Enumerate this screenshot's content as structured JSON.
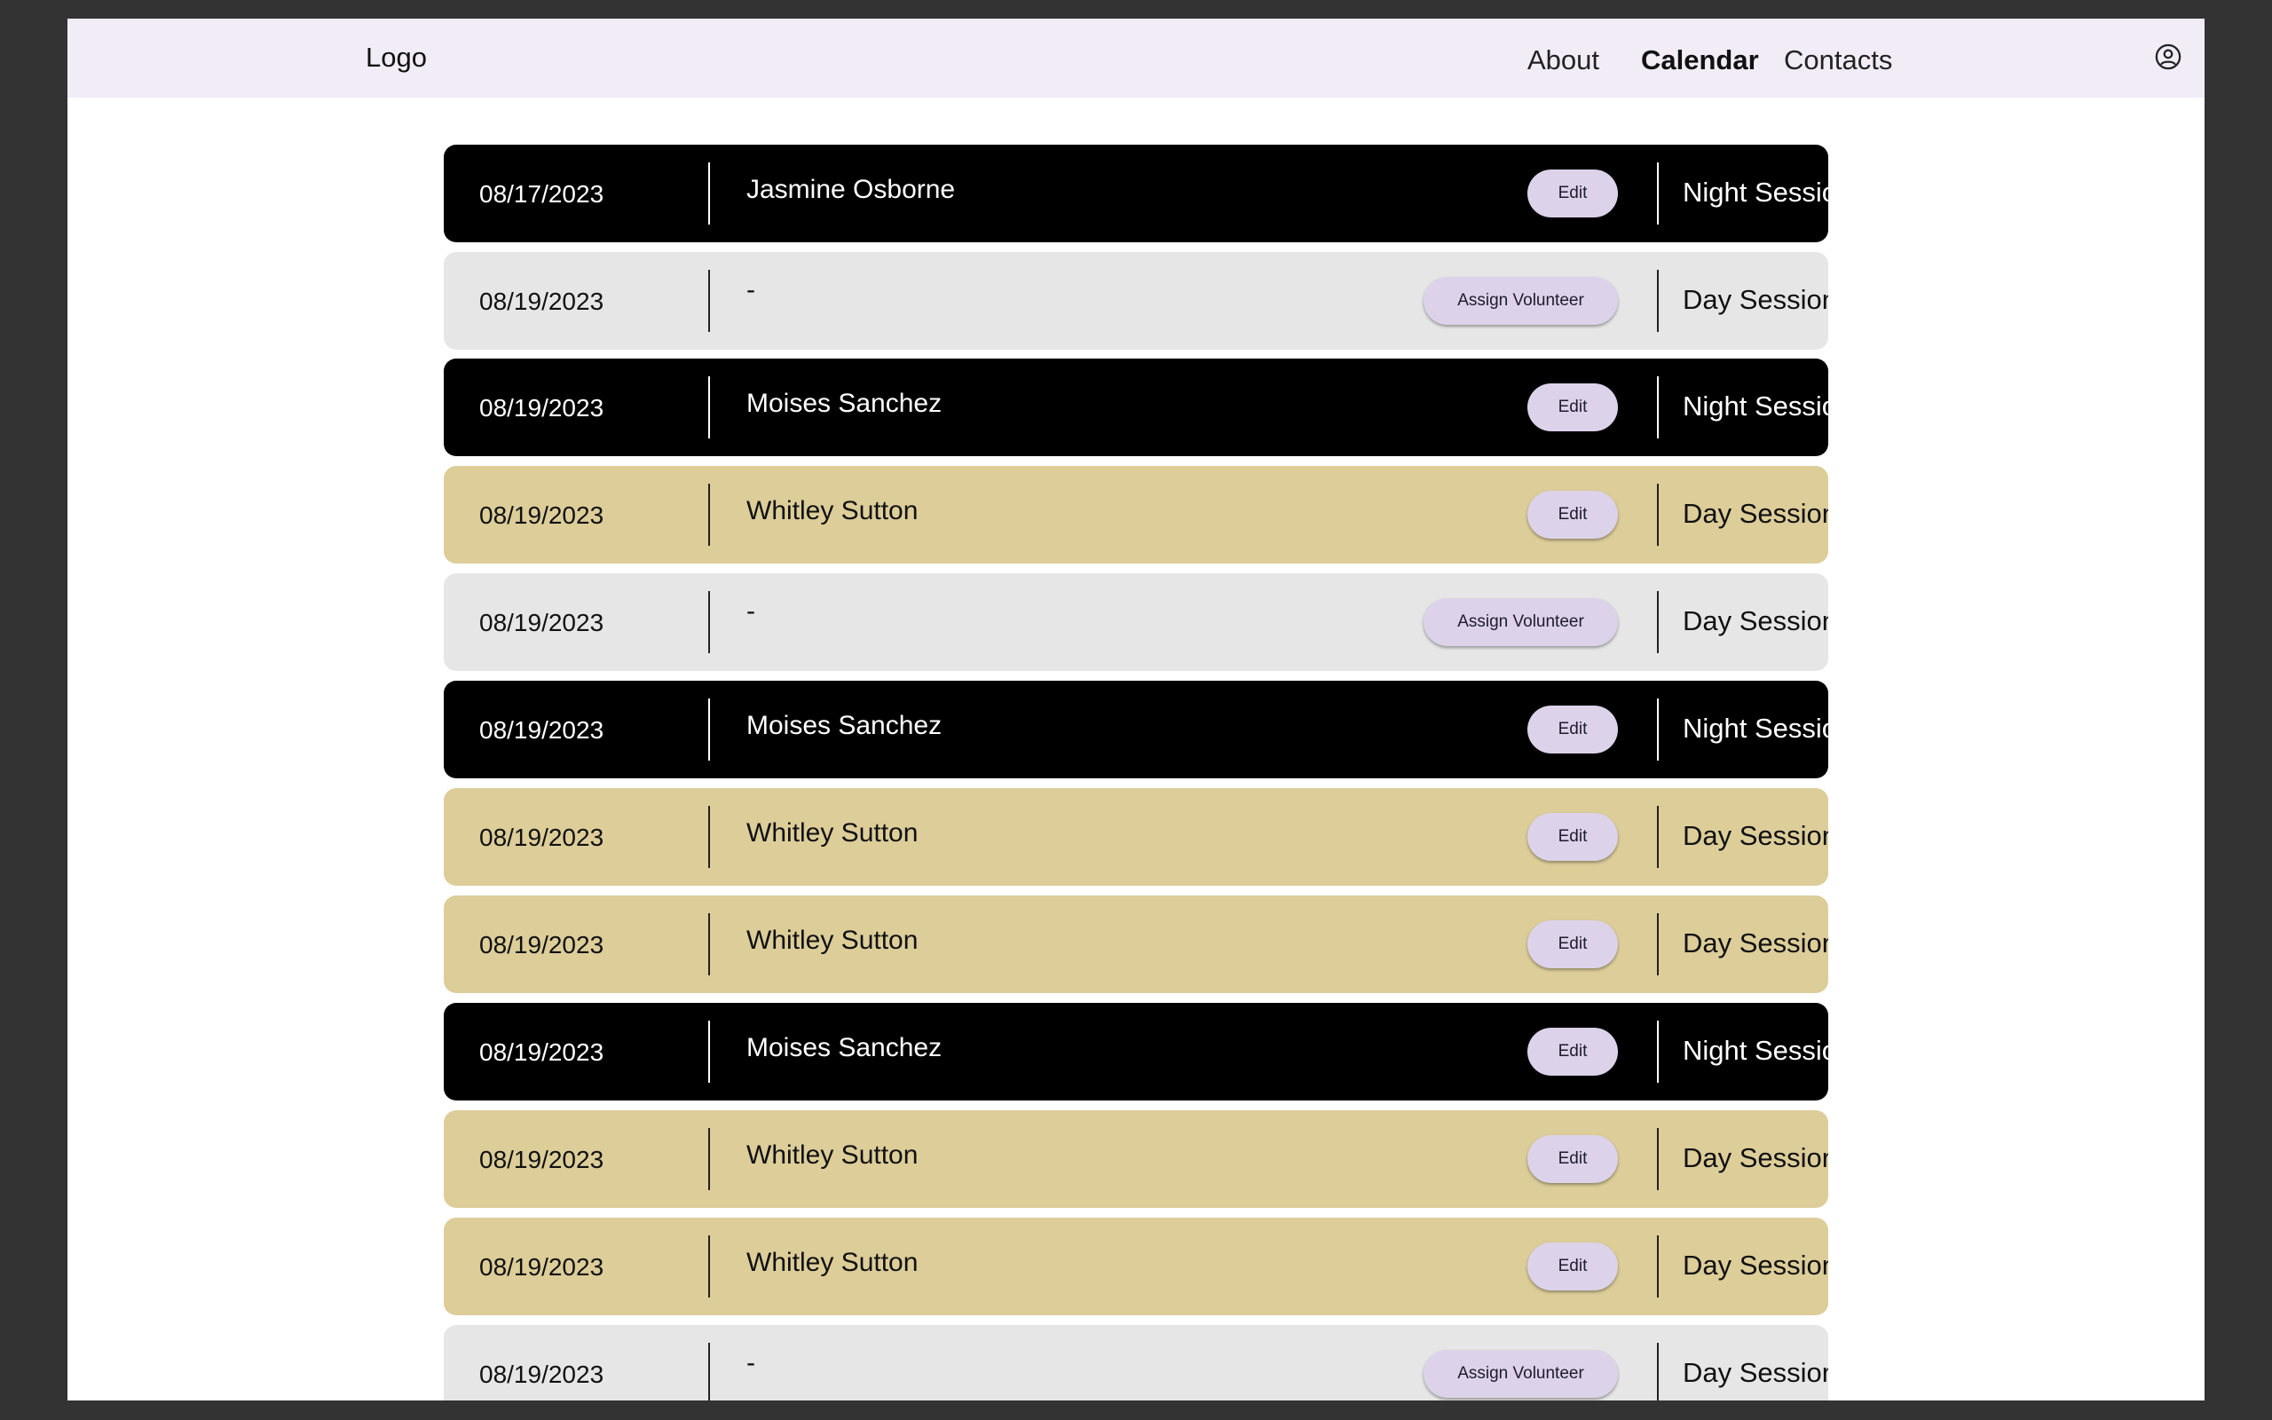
{
  "nav": {
    "logo": "Logo",
    "links": [
      {
        "label": "About",
        "active": false
      },
      {
        "label": "Calendar",
        "active": true
      },
      {
        "label": "Contacts",
        "active": false
      }
    ],
    "account_icon": "account-circle-icon"
  },
  "colors": {
    "nav_bg": "#f2ecf7",
    "night_row": "#000000",
    "day_row": "#dccd99",
    "open_row": "#e6e6e6",
    "button_bg": "#dcd3ea"
  },
  "shifts": [
    {
      "date": "08/17/2023",
      "volunteer": "Jasmine Osborne",
      "action": "Edit",
      "session": "Night Session",
      "kind": "night"
    },
    {
      "date": "08/19/2023",
      "volunteer": "-",
      "action": "Assign Volunteer",
      "session": "Day Session",
      "kind": "open"
    },
    {
      "date": "08/19/2023",
      "volunteer": "Moises Sanchez",
      "action": "Edit",
      "session": "Night Session",
      "kind": "night"
    },
    {
      "date": "08/19/2023",
      "volunteer": "Whitley Sutton",
      "action": "Edit",
      "session": "Day Session",
      "kind": "day"
    },
    {
      "date": "08/19/2023",
      "volunteer": "-",
      "action": "Assign Volunteer",
      "session": "Day Session",
      "kind": "open"
    },
    {
      "date": "08/19/2023",
      "volunteer": "Moises Sanchez",
      "action": "Edit",
      "session": "Night Session",
      "kind": "night"
    },
    {
      "date": "08/19/2023",
      "volunteer": "Whitley Sutton",
      "action": "Edit",
      "session": "Day Session",
      "kind": "day"
    },
    {
      "date": "08/19/2023",
      "volunteer": "Whitley Sutton",
      "action": "Edit",
      "session": "Day Session",
      "kind": "day"
    },
    {
      "date": "08/19/2023",
      "volunteer": "Moises Sanchez",
      "action": "Edit",
      "session": "Night Session",
      "kind": "night"
    },
    {
      "date": "08/19/2023",
      "volunteer": "Whitley Sutton",
      "action": "Edit",
      "session": "Day Session",
      "kind": "day"
    },
    {
      "date": "08/19/2023",
      "volunteer": "Whitley Sutton",
      "action": "Edit",
      "session": "Day Session",
      "kind": "day"
    },
    {
      "date": "08/19/2023",
      "volunteer": "-",
      "action": "Assign Volunteer",
      "session": "Day Session",
      "kind": "open"
    }
  ]
}
